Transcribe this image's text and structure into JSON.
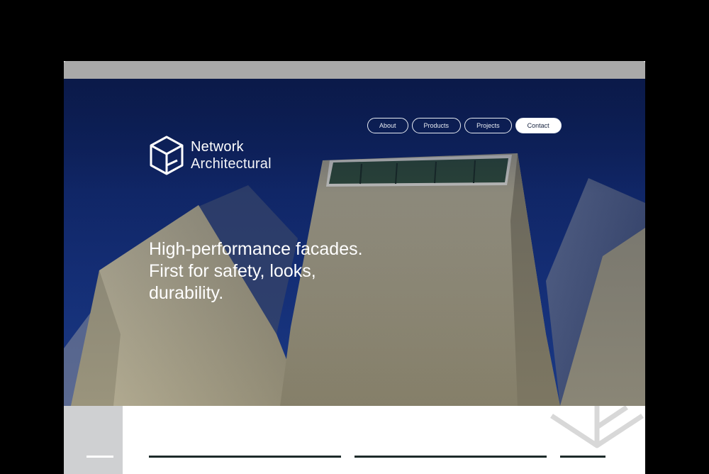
{
  "brand": {
    "name_line1": "Network",
    "name_line2": "Architectural"
  },
  "nav": {
    "items": [
      {
        "label": "About",
        "active": false
      },
      {
        "label": "Products",
        "active": false
      },
      {
        "label": "Projects",
        "active": false
      },
      {
        "label": "Contact",
        "active": true
      }
    ]
  },
  "hero": {
    "headline_lines": [
      "High-performance facades.",
      "First for safety, looks,",
      "durability."
    ]
  },
  "icons": {
    "logo": "cube-logo-icon",
    "decoration": "cube-outline-icon"
  },
  "colors": {
    "sky": "#0f2462",
    "building": "#b8b197",
    "lower_panel": "#cfd0d2",
    "rule": "#1d2b2a"
  }
}
